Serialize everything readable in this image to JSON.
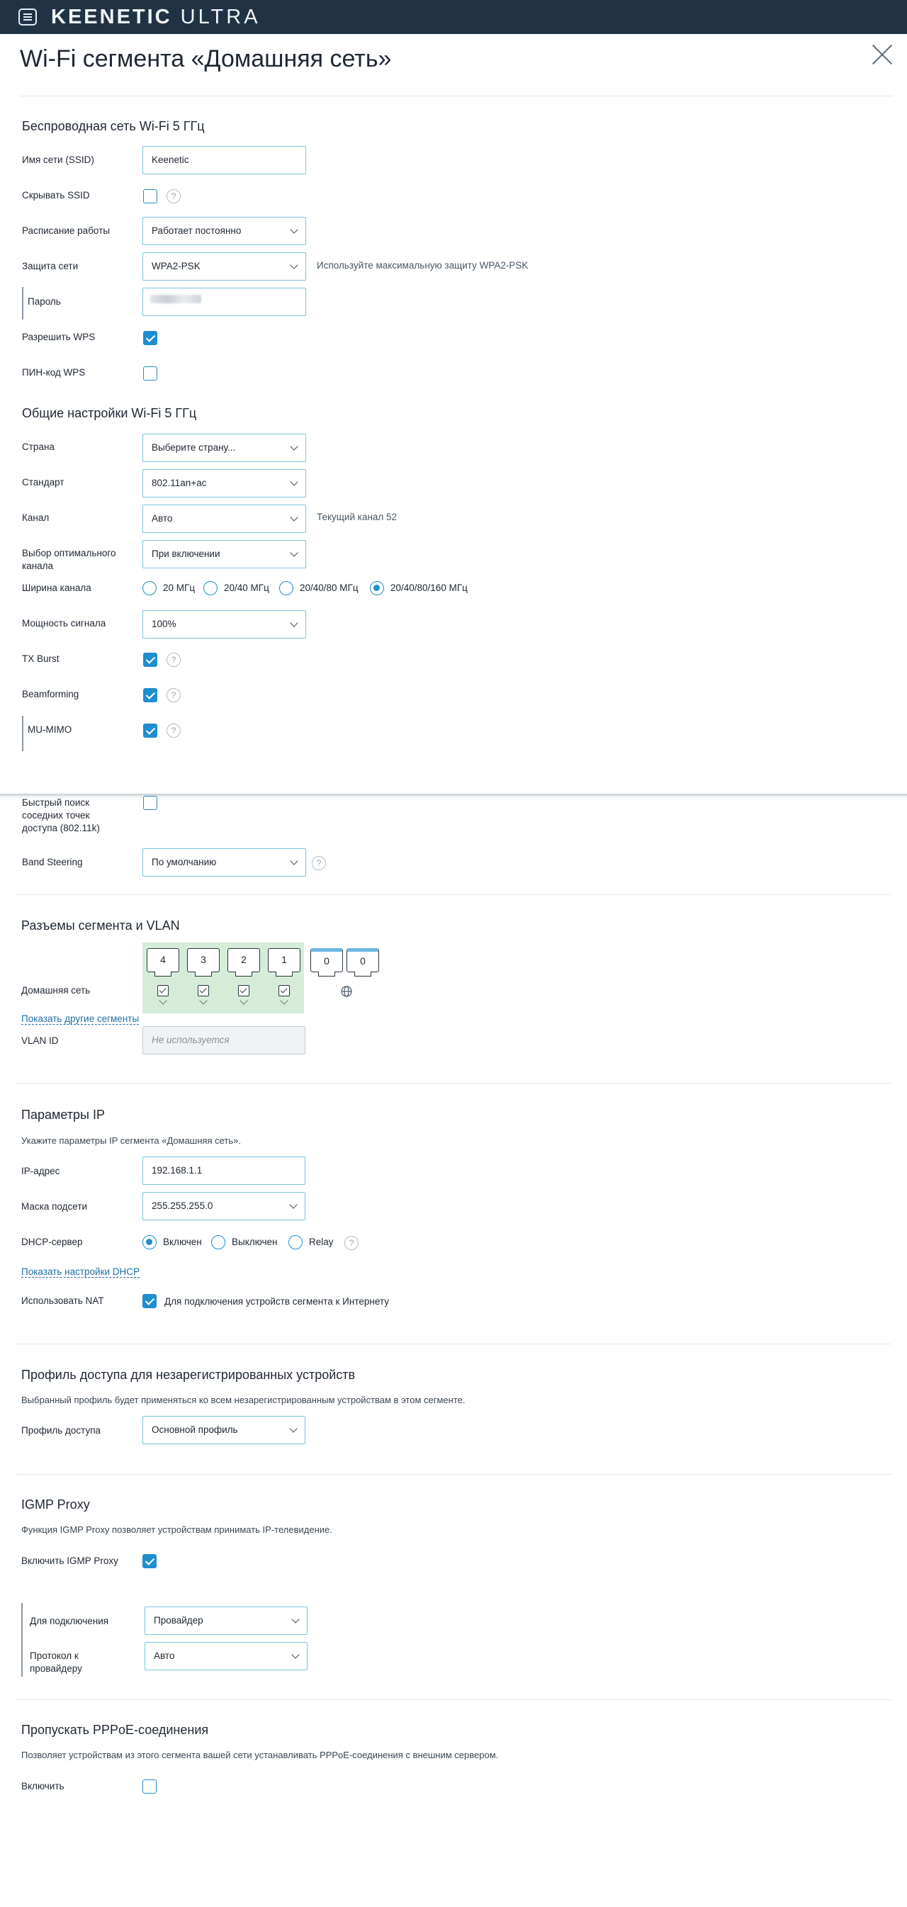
{
  "header": {
    "brand_main": "KEENETIC",
    "brand_sub": "ULTRA"
  },
  "page_title": "Wi-Fi сегмента «Домашняя сеть»",
  "wireless": {
    "section_title": "Беспроводная сеть Wi-Fi 5 ГГц",
    "ssid_label": "Имя сети (SSID)",
    "ssid_value": "Keenetic",
    "hide_ssid_label": "Скрывать SSID",
    "schedule_label": "Расписание работы",
    "schedule_value": "Работает постоянно",
    "security_label": "Защита сети",
    "security_value": "WPA2-PSK",
    "security_hint": "Используйте максимальную защиту WPA2-PSK",
    "password_label": "Пароль",
    "wps_label": "Разрешить WPS",
    "wps_pin_label": "ПИН-код WPS"
  },
  "general": {
    "section_title": "Общие настройки Wi-Fi 5 ГГц",
    "country_label": "Страна",
    "country_value": "Выберите страну...",
    "standard_label": "Стандарт",
    "standard_value": "802.11an+ac",
    "channel_label": "Канал",
    "channel_value": "Авто",
    "channel_hint": "Текущий канал 52",
    "optimal_label_1": "Выбор оптимального",
    "optimal_label_2": "канала",
    "optimal_value": "При включении",
    "width_label": "Ширина канала",
    "width_options": [
      "20 МГц",
      "20/40 МГц",
      "20/40/80 МГц",
      "20/40/80/160 МГц"
    ],
    "power_label": "Мощность сигнала",
    "power_value": "100%",
    "txburst_label": "TX Burst",
    "beamforming_label": "Beamforming",
    "mumimo_label": "MU-MIMO",
    "fast_label_1": "Быстрый поиск",
    "fast_label_2": "соседних точек",
    "fast_label_3": "доступа (802.11k)",
    "band_label": "Band Steering",
    "band_value": "По умолчанию"
  },
  "ports": {
    "section_title": "Разъемы сегмента и VLAN",
    "segment_label": "Домашняя сеть",
    "port_numbers": [
      "4",
      "3",
      "2",
      "1"
    ],
    "extra_ports": [
      "0",
      "0"
    ],
    "show_other_link": "Показать другие сегменты",
    "vlan_label": "VLAN ID",
    "vlan_placeholder": "Не используется"
  },
  "ip": {
    "section_title": "Параметры IP",
    "description": "Укажите параметры IP сегмента «Домашняя сеть».",
    "address_label": "IP-адрес",
    "address_value": "192.168.1.1",
    "mask_label": "Маска подсети",
    "mask_value": "255.255.255.0",
    "dhcp_label": "DHCP-сервер",
    "dhcp_options": [
      "Включен",
      "Выключен",
      "Relay"
    ],
    "show_dhcp_link": "Показать настройки DHCP",
    "nat_label": "Использовать NAT",
    "nat_hint": "Для подключения устройств сегмента к Интернету"
  },
  "access": {
    "section_title": "Профиль доступа для незарегистрированных устройств",
    "description": "Выбранный профиль будет применяться ко всем незарегистрированным устройствам в этом сегменте.",
    "profile_label": "Профиль доступа",
    "profile_value": "Основной профиль"
  },
  "igmp": {
    "section_title": "IGMP Proxy",
    "description": "Функция IGMP Proxy позволяет устройствам принимать IP-телевидение.",
    "enable_label": "Включить IGMP Proxy",
    "connection_label": "Для подключения",
    "connection_value": "Провайдер",
    "protocol_label_1": "Протокол к",
    "protocol_label_2": "провайдеру",
    "protocol_value": "Авто"
  },
  "pppoe": {
    "section_title": "Пропускать PPPoE-соединения",
    "description": "Позволяет устройствам из этого сегмента вашей сети устанавливать PPPoE-соединения с внешним сервером.",
    "enable_label": "Включить"
  },
  "help_glyph": "?",
  "colors": {
    "header_bg": "#1f3344",
    "accent": "#1f8ecf",
    "field_border": "#7cc4de",
    "ports_bg": "#d6ecd9"
  }
}
